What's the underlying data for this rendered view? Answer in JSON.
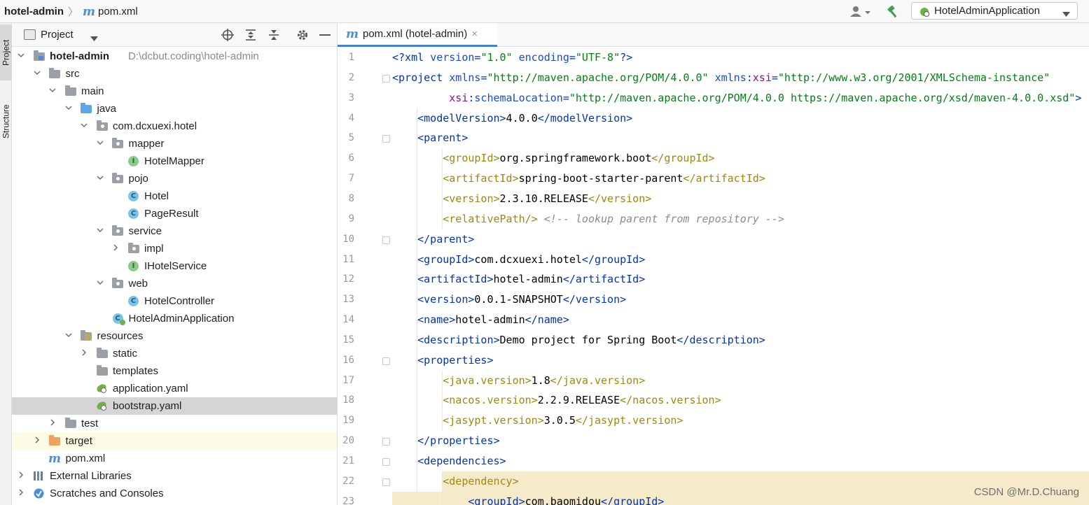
{
  "breadcrumb": {
    "project": "hotel-admin",
    "separator": "〉",
    "file_icon": "m",
    "file": "pom.xml"
  },
  "toolbar": {
    "user_icon": "user-icon",
    "build_icon": "hammer-icon",
    "run_config": "HotelAdminApplication"
  },
  "side_stripe": {
    "project_tab": "Project",
    "structure_tab": "Structure"
  },
  "project_panel": {
    "title": "Project",
    "tree": [
      {
        "label": "hotel-admin",
        "hint": "D:\\dcbut.coding\\hotel-admin",
        "level": 0,
        "arrow": "down",
        "icon": "module-folder",
        "bold": true
      },
      {
        "label": "src",
        "level": 1,
        "arrow": "down",
        "icon": "folder"
      },
      {
        "label": "main",
        "level": 2,
        "arrow": "down",
        "icon": "folder"
      },
      {
        "label": "java",
        "level": 3,
        "arrow": "down",
        "icon": "source-folder"
      },
      {
        "label": "com.dcxuexi.hotel",
        "level": 4,
        "arrow": "down",
        "icon": "package"
      },
      {
        "label": "mapper",
        "level": 5,
        "arrow": "down",
        "icon": "package"
      },
      {
        "label": "HotelMapper",
        "level": 6,
        "arrow": "",
        "icon": "interface"
      },
      {
        "label": "pojo",
        "level": 5,
        "arrow": "down",
        "icon": "package"
      },
      {
        "label": "Hotel",
        "level": 6,
        "arrow": "",
        "icon": "class"
      },
      {
        "label": "PageResult",
        "level": 6,
        "arrow": "",
        "icon": "class"
      },
      {
        "label": "service",
        "level": 5,
        "arrow": "down",
        "icon": "package"
      },
      {
        "label": "impl",
        "level": 6,
        "arrow": "right",
        "icon": "package"
      },
      {
        "label": "IHotelService",
        "level": 6,
        "arrow": "",
        "icon": "interface"
      },
      {
        "label": "web",
        "level": 5,
        "arrow": "down",
        "icon": "package"
      },
      {
        "label": "HotelController",
        "level": 6,
        "arrow": "",
        "icon": "class"
      },
      {
        "label": "HotelAdminApplication",
        "level": 5,
        "arrow": "",
        "icon": "spring-class"
      },
      {
        "label": "resources",
        "level": 3,
        "arrow": "down",
        "icon": "resources-folder"
      },
      {
        "label": "static",
        "level": 4,
        "arrow": "right",
        "icon": "folder"
      },
      {
        "label": "templates",
        "level": 4,
        "arrow": "",
        "icon": "folder"
      },
      {
        "label": "application.yaml",
        "level": 4,
        "arrow": "",
        "icon": "yaml"
      },
      {
        "label": "bootstrap.yaml",
        "level": 4,
        "arrow": "",
        "icon": "yaml",
        "selected": true
      },
      {
        "label": "test",
        "level": 2,
        "arrow": "right",
        "icon": "folder"
      },
      {
        "label": "target",
        "level": 1,
        "arrow": "right",
        "icon": "excluded-folder",
        "highlight": true
      },
      {
        "label": "pom.xml",
        "level": 1,
        "arrow": "",
        "icon": "maven"
      },
      {
        "label": "External Libraries",
        "level": 0,
        "arrow": "right",
        "icon": "libraries"
      },
      {
        "label": "Scratches and Consoles",
        "level": 0,
        "arrow": "right",
        "icon": "scratches"
      }
    ]
  },
  "editor_tab": {
    "label": "pom.xml (hotel-admin)",
    "close": "×"
  },
  "code": [
    {
      "n": "1",
      "indent": 0,
      "parts": [
        [
          "pi",
          "<?xml "
        ],
        [
          "attr",
          "version"
        ],
        [
          "pi",
          "="
        ],
        [
          "val",
          "\"1.0\""
        ],
        [
          "pi",
          " "
        ],
        [
          "attr",
          "encoding"
        ],
        [
          "pi",
          "="
        ],
        [
          "val",
          "\"UTF-8\""
        ],
        [
          "pi",
          "?>"
        ]
      ]
    },
    {
      "n": "2",
      "indent": 0,
      "parts": [
        [
          "tag",
          "<project "
        ],
        [
          "attr",
          "xmlns"
        ],
        [
          "tag",
          "="
        ],
        [
          "val",
          "\"http://maven.apache.org/POM/4.0.0\""
        ],
        [
          "tag",
          " "
        ],
        [
          "attr",
          "xmlns"
        ],
        [
          "tag",
          ":"
        ],
        [
          "ns",
          "xsi"
        ],
        [
          "tag",
          "="
        ],
        [
          "val",
          "\"http://www.w3.org/2001/XMLSchema-instance\""
        ]
      ]
    },
    {
      "n": "3",
      "indent": 0,
      "parts": [
        [
          "text",
          "         "
        ],
        [
          "ns",
          "xsi"
        ],
        [
          "tag",
          ":"
        ],
        [
          "attr",
          "schemaLocation"
        ],
        [
          "tag",
          "="
        ],
        [
          "val",
          "\"http://maven.apache.org/POM/4.0.0 https://maven.apache.org/xsd/maven-4.0.0.xsd\""
        ],
        [
          "tag",
          ">"
        ]
      ]
    },
    {
      "n": "4",
      "indent": 1,
      "parts": [
        [
          "tag",
          "<modelVersion>"
        ],
        [
          "text",
          "4.0.0"
        ],
        [
          "tag",
          "</modelVersion>"
        ]
      ]
    },
    {
      "n": "5",
      "indent": 1,
      "parts": [
        [
          "tag",
          "<parent>"
        ]
      ]
    },
    {
      "n": "6",
      "indent": 2,
      "parts": [
        [
          "ytag",
          "<groupId>"
        ],
        [
          "text",
          "org.springframework.boot"
        ],
        [
          "ytag",
          "</groupId>"
        ]
      ]
    },
    {
      "n": "7",
      "indent": 2,
      "parts": [
        [
          "ytag",
          "<artifactId>"
        ],
        [
          "text",
          "spring-boot-starter-parent"
        ],
        [
          "ytag",
          "</artifactId>"
        ]
      ]
    },
    {
      "n": "8",
      "indent": 2,
      "parts": [
        [
          "ytag",
          "<version>"
        ],
        [
          "text",
          "2.3.10.RELEASE"
        ],
        [
          "ytag",
          "</version>"
        ]
      ]
    },
    {
      "n": "9",
      "indent": 2,
      "parts": [
        [
          "ytag",
          "<relativePath/>"
        ],
        [
          "text",
          " "
        ],
        [
          "comment",
          "<!-- lookup parent from repository -->"
        ]
      ]
    },
    {
      "n": "10",
      "indent": 1,
      "parts": [
        [
          "tag",
          "</parent>"
        ]
      ]
    },
    {
      "n": "11",
      "indent": 1,
      "parts": [
        [
          "tag",
          "<groupId>"
        ],
        [
          "text",
          "com.dcxuexi.hotel"
        ],
        [
          "tag",
          "</groupId>"
        ]
      ]
    },
    {
      "n": "12",
      "indent": 1,
      "parts": [
        [
          "tag",
          "<artifactId>"
        ],
        [
          "text",
          "hotel-admin"
        ],
        [
          "tag",
          "</artifactId>"
        ]
      ]
    },
    {
      "n": "13",
      "indent": 1,
      "parts": [
        [
          "tag",
          "<version>"
        ],
        [
          "text",
          "0.0.1-SNAPSHOT"
        ],
        [
          "tag",
          "</version>"
        ]
      ]
    },
    {
      "n": "14",
      "indent": 1,
      "parts": [
        [
          "tag",
          "<name>"
        ],
        [
          "text",
          "hotel-admin"
        ],
        [
          "tag",
          "</name>"
        ]
      ]
    },
    {
      "n": "15",
      "indent": 1,
      "parts": [
        [
          "tag",
          "<description>"
        ],
        [
          "text",
          "Demo project for Spring Boot"
        ],
        [
          "tag",
          "</description>"
        ]
      ]
    },
    {
      "n": "16",
      "indent": 1,
      "parts": [
        [
          "tag",
          "<properties>"
        ]
      ]
    },
    {
      "n": "17",
      "indent": 2,
      "parts": [
        [
          "ytag",
          "<java.version>"
        ],
        [
          "text",
          "1.8"
        ],
        [
          "ytag",
          "</java.version>"
        ]
      ]
    },
    {
      "n": "18",
      "indent": 2,
      "parts": [
        [
          "ytag",
          "<nacos.version>"
        ],
        [
          "text",
          "2.2.9.RELEASE"
        ],
        [
          "ytag",
          "</nacos.version>"
        ]
      ]
    },
    {
      "n": "19",
      "indent": 2,
      "parts": [
        [
          "ytag",
          "<jasypt.version>"
        ],
        [
          "text",
          "3.0.5"
        ],
        [
          "ytag",
          "</jasypt.version>"
        ]
      ]
    },
    {
      "n": "20",
      "indent": 1,
      "parts": [
        [
          "tag",
          "</properties>"
        ]
      ]
    },
    {
      "n": "21",
      "indent": 1,
      "parts": [
        [
          "tag",
          "<dependencies>"
        ]
      ]
    },
    {
      "n": "22",
      "indent": 2,
      "parts": [
        [
          "ytag",
          "<dependency>"
        ]
      ],
      "highlight": "tag"
    },
    {
      "n": "23",
      "indent": 3,
      "parts": [
        [
          "tag",
          "<groupId>"
        ],
        [
          "text",
          "com.baomidou"
        ],
        [
          "tag",
          "</groupId>"
        ]
      ],
      "highlight": "line"
    }
  ],
  "watermark": "CSDN @Mr.D.Chuang",
  "colors": {
    "tag": "#0033b3",
    "ytag": "#9e880d",
    "val": "#067d17",
    "attr": "#174ad4",
    "ns": "#871094",
    "comment": "#8c8c8c",
    "selection": "#d5d5d5",
    "match_highlight": "#f5eaca",
    "tab_underline": "#4083c9"
  }
}
